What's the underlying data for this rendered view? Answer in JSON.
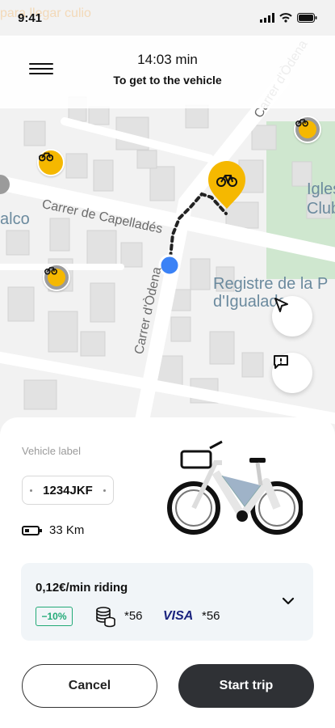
{
  "status_bar": {
    "time": "9:41"
  },
  "header": {
    "eta_time": "14:03 min",
    "eta_subtitle": "To get to the vehicle",
    "faded_text": "para llegar\nculio"
  },
  "map": {
    "streets": [
      "Carrer de Capelladés",
      "Carrer d'Òdena",
      "Carrer d'Òdena",
      "Carrer d'Òdena"
    ],
    "places": [
      "Iglesia\nClub",
      "alco",
      "Registre de la P\nd'Igualada"
    ]
  },
  "vehicle": {
    "label_caption": "Vehicle label",
    "plate": "1234JKF",
    "range": "33 Km"
  },
  "pricing": {
    "rate": "0,12€/min riding",
    "discount": "−10%",
    "credits": "*56",
    "card_brand": "VISA",
    "card_last": "*56"
  },
  "actions": {
    "cancel": "Cancel",
    "start": "Start trip"
  },
  "colors": {
    "accent": "#f5b800",
    "primary_button": "#2f3135",
    "discount": "#22aa77",
    "location": "#3b82f6"
  }
}
